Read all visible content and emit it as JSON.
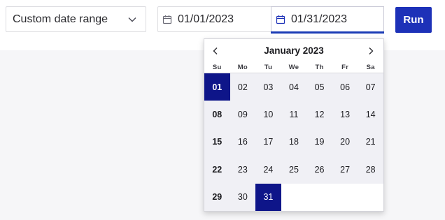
{
  "filter": {
    "range_select_value": "Custom date range",
    "start_date": "01/01/2023",
    "end_date": "01/31/2023",
    "run_label": "Run"
  },
  "calendar": {
    "month_label": "January 2023",
    "weekdays": [
      "Su",
      "Mo",
      "Tu",
      "We",
      "Th",
      "Fr",
      "Sa"
    ],
    "days": [
      "01",
      "02",
      "03",
      "04",
      "05",
      "06",
      "07",
      "08",
      "09",
      "10",
      "11",
      "12",
      "13",
      "14",
      "15",
      "16",
      "17",
      "18",
      "19",
      "20",
      "21",
      "22",
      "23",
      "24",
      "25",
      "26",
      "27",
      "28",
      "29",
      "30",
      "31"
    ],
    "selected_days": [
      "01",
      "31"
    ]
  },
  "icons": {
    "select_chevron": "chevron-down-icon",
    "date_icon": "calendar-icon",
    "prev": "chevron-left-icon",
    "next": "chevron-right-icon"
  },
  "colors": {
    "accent": "#1d31b8",
    "selected_day": "#0e1589",
    "day_bg": "#f0f0f5"
  }
}
